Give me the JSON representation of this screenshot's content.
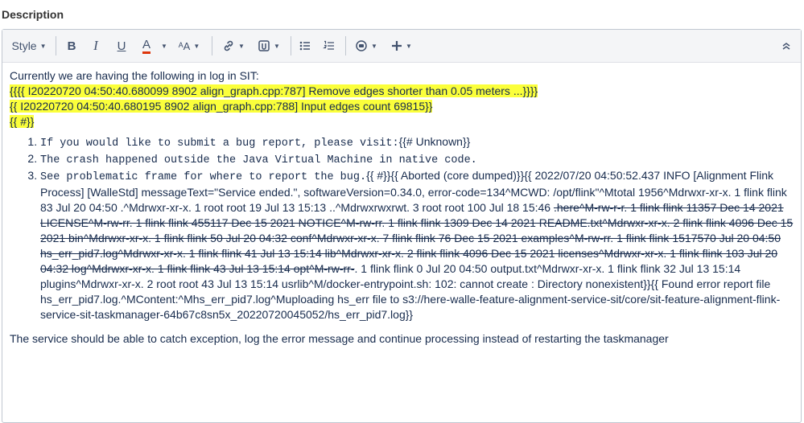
{
  "field_label": "Description",
  "toolbar": {
    "style_label": "Style",
    "bold_label": "B",
    "italic_label": "I",
    "underline_label": "U",
    "text_color_label": "A",
    "text_size_label": "ᴬA",
    "link_icon": "link-icon",
    "attachment_icon": "paperclip-icon",
    "bullet_list_icon": "bullet-list-icon",
    "numbered_list_icon": "numbered-list-icon",
    "emoji_icon": "emoji-icon",
    "insert_icon": "plus-icon",
    "collapse_icon": "double-chevron-up-icon",
    "accent_red": "#de350b",
    "highlight_color": "#fbff3b"
  },
  "content": {
    "intro": "Currently we are having the following in log in SIT:",
    "log1": "{{{{ I20220720 04:50:40.680099  8902 align_graph.cpp:787] Remove edges shorter than 0.05 meters ...}}}}",
    "log2": "{{ I20220720 04:50:40.680195  8902 align_graph.cpp:788] Input edges count 69815}}",
    "log3": "{{ #}}",
    "item1_mono": "If you would like to submit a bug report, please visit:",
    "item1_tail": "{{#  Unknown}}",
    "item2_mono": "The crash happened outside the Java Virtual Machine in native code.",
    "item3_mono": "See problematic frame for where to report the bug.",
    "item3_a": "{{ #}}{{ Aborted (core dumped)}}{{ 2022/07/20 04:50:52.437  INFO [Alignment Flink Process] [WalleStd] messageText=\"Service ended.\", softwareVersion=0.34.0, error-code=134^MCWD: /opt/flink\"^Mtotal 1956^Mdrwxr-xr-x. 1 flink flink      83 Jul 20 04:50 .^Mdrwxr-xr-x. 1 root  root       19 Jul 13 15:13 ..^Mdrwxrwxrwt. 3 root  root      100 Jul 18 15:46 ",
    "item3_strike": ".here^M-rw-r-r. 1 flink flink   11357 Dec 14  2021 LICENSE^M-rw-rr. 1 flink flink  455117 Dec 15  2021 NOTICE^M-rw-rr. 1 flink flink    1309 Dec 14  2021 README.txt^Mdrwxr-xr-x. 2 flink flink    4096 Dec 15  2021 bin^Mdrwxr-xr-x. 1 flink flink      50 Jul 20 04:32 conf^Mdrwxr-xr-x. 7 flink flink      76 Dec 15  2021 examples^M-rw-rr. 1 flink flink 1517570 Jul 20 04:50 hs_err_pid7.log^Mdrwxr-xr-x. 1 flink flink      41 Jul 13 15:14 lib^Mdrwxr-xr-x. 2 flink flink    4096 Dec 15  2021 licenses^Mdrwxr-xr-x. 1 flink flink     103 Jul 20 04:32 log^Mdrwxr-xr-x. 1 flink flink      43 Jul 13 15:14 opt^M-rw-rr-",
    "item3_b": ". 1 flink flink       0 Jul 20 04:50 output.txt^Mdrwxr-xr-x. 1 flink flink      32 Jul 13 15:14 plugins^Mdrwxr-xr-x. 2 root  root       43 Jul 13 15:14 usrlib^M/docker-entrypoint.sh: 102: cannot create : Directory nonexistent}}{{ Found error report file hs_err_pid7.log.^MContent:^Mhs_err_pid7.log^Muploading hs_err file to s3://here-walle-feature-alignment-service-sit/core/sit-feature-alignment-flink-service-sit-taskmanager-64b67c8sn5x_20220720045052/hs_err_pid7.log}}",
    "closing": "The service should be able to catch exception, log the error message and continue processing instead of restarting the taskmanager"
  }
}
